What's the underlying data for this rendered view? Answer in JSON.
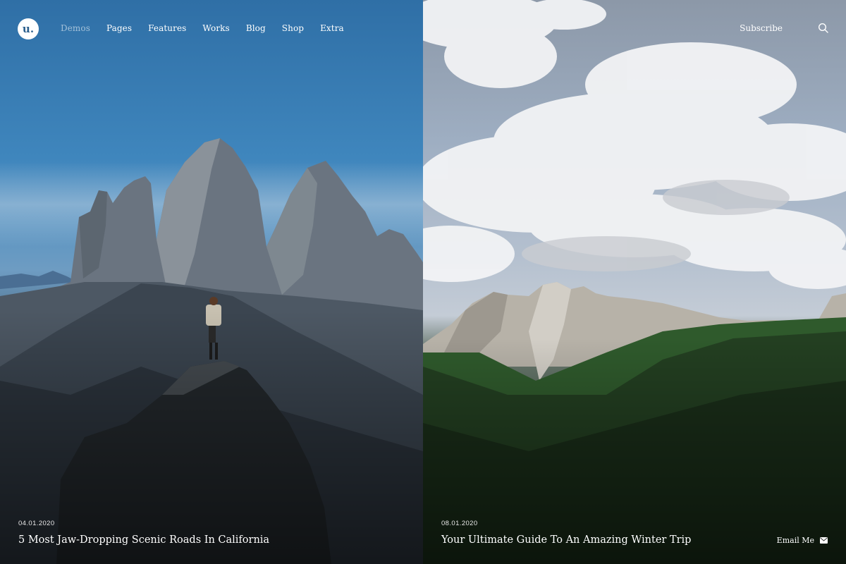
{
  "header": {
    "logo_text": "u.",
    "nav": [
      {
        "label": "Demos",
        "active": true
      },
      {
        "label": "Pages",
        "active": false
      },
      {
        "label": "Features",
        "active": false
      },
      {
        "label": "Works",
        "active": false
      },
      {
        "label": "Blog",
        "active": false
      },
      {
        "label": "Shop",
        "active": false
      },
      {
        "label": "Extra",
        "active": false
      }
    ],
    "subscribe_label": "Subscribe",
    "search_icon": "search-icon"
  },
  "slides": [
    {
      "date": "04.01.2020",
      "title": "5 Most Jaw-Dropping Scenic Roads In California"
    },
    {
      "date": "08.01.2020",
      "title": "Your Ultimate Guide To An Amazing Winter Trip"
    }
  ],
  "footer": {
    "email_label": "Email Me",
    "email_icon": "envelope-icon"
  },
  "colors": {
    "logo_text": "#2a5e8c",
    "nav_active": "rgba(255,255,255,0.55)",
    "text": "#ffffff"
  }
}
